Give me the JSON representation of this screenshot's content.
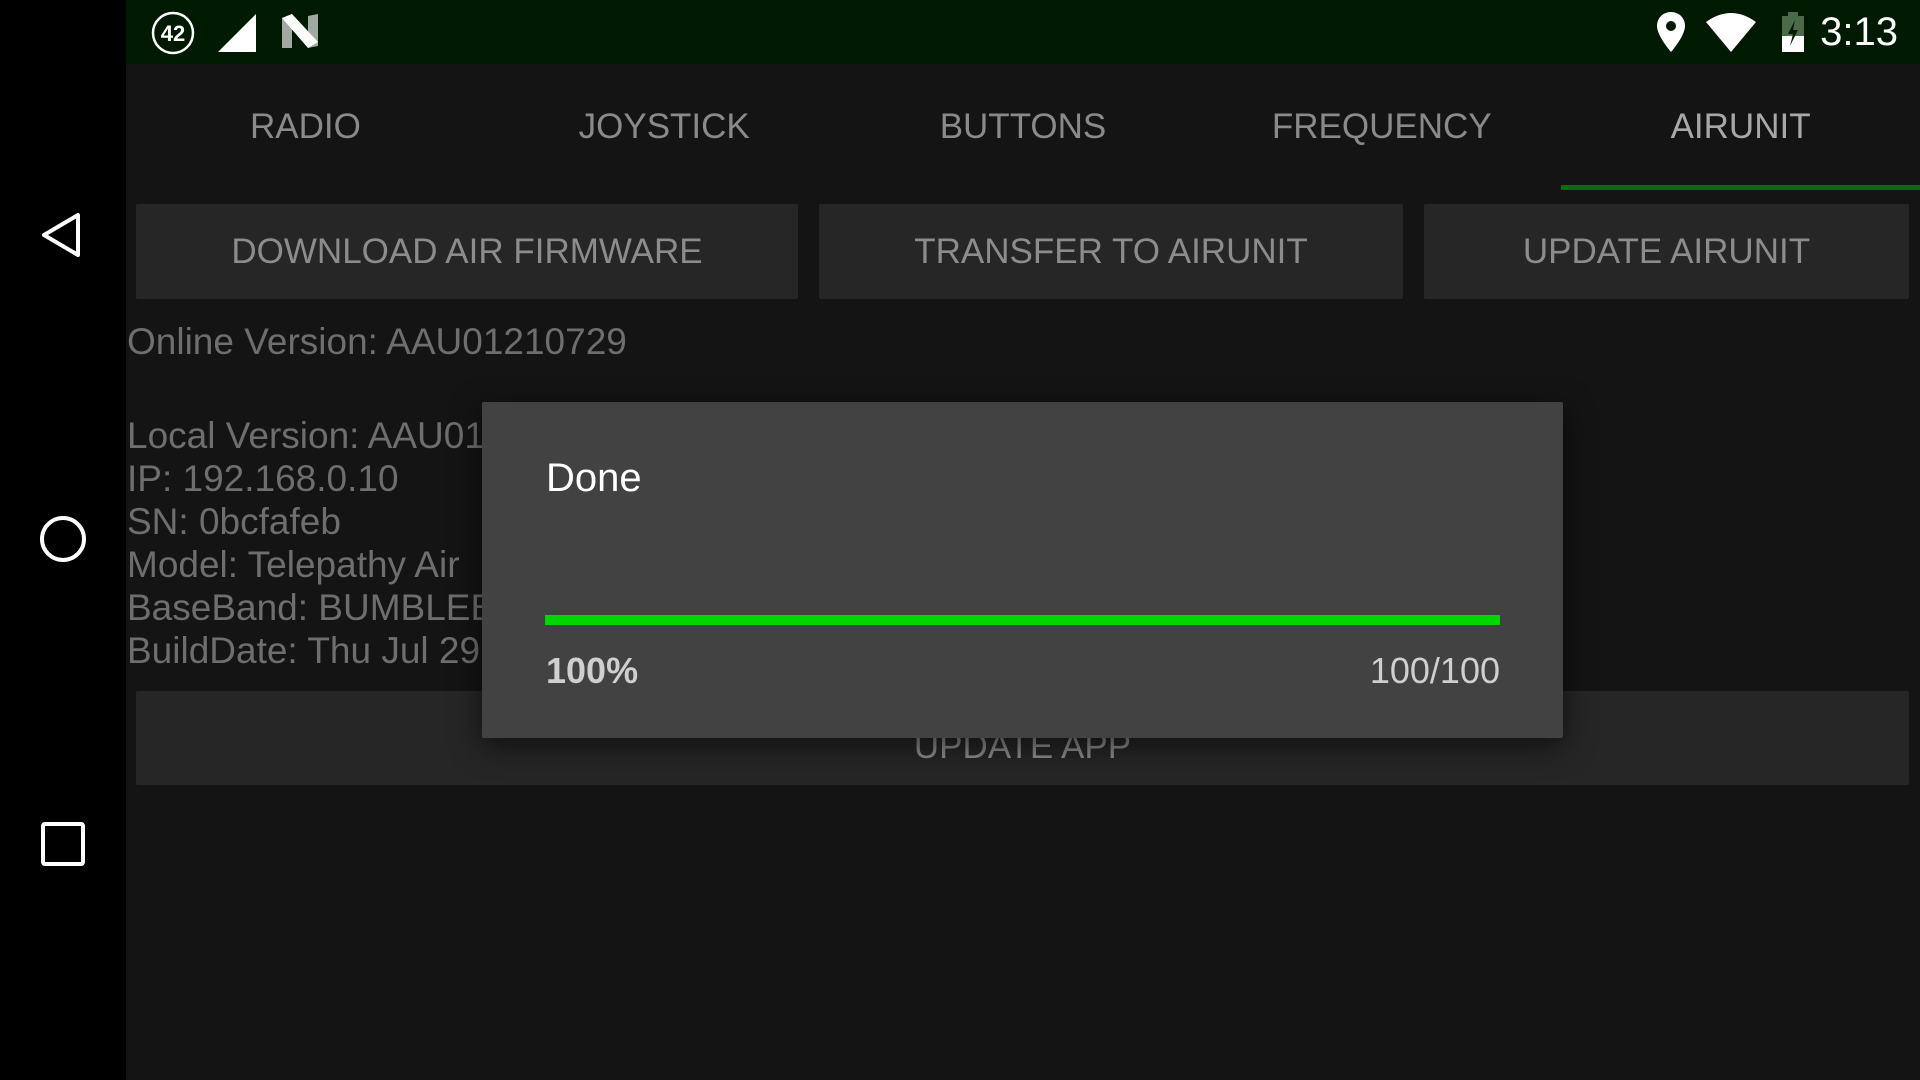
{
  "status_bar": {
    "notification_badge": "42",
    "icons": [
      "notification-count-icon",
      "cell-signal-icon",
      "n-app-icon",
      "location-icon",
      "wifi-icon",
      "battery-charging-icon"
    ],
    "time": "3:13"
  },
  "nav_bar": {
    "icons": [
      "back-icon",
      "home-icon",
      "recents-icon"
    ]
  },
  "tabs": [
    {
      "label": "RADIO"
    },
    {
      "label": "JOYSTICK"
    },
    {
      "label": "BUTTONS"
    },
    {
      "label": "FREQUENCY"
    },
    {
      "label": "AIRUNIT",
      "active": true
    }
  ],
  "actions": {
    "download": "DOWNLOAD AIR FIRMWARE",
    "transfer": "TRANSFER TO AIRUNIT",
    "update": "UPDATE AIRUNIT",
    "update_app": "UPDATE APP"
  },
  "info": {
    "online_version": "Online Version: AAU01210729",
    "lines": [
      "Local Version: AAU01",
      "IP: 192.168.0.10",
      "SN: 0bcfafeb",
      "Model: Telepathy Air",
      "BaseBand: BUMBLEB",
      "BuildDate: Thu Jul 29"
    ]
  },
  "dialog": {
    "title": "Done",
    "progress_percent": 100,
    "percent_label": "100%",
    "count_label": "100/100"
  },
  "colors": {
    "accent": "#00d600",
    "status_bar": "#001a02",
    "tab_indicator": "#0a6b0a"
  }
}
